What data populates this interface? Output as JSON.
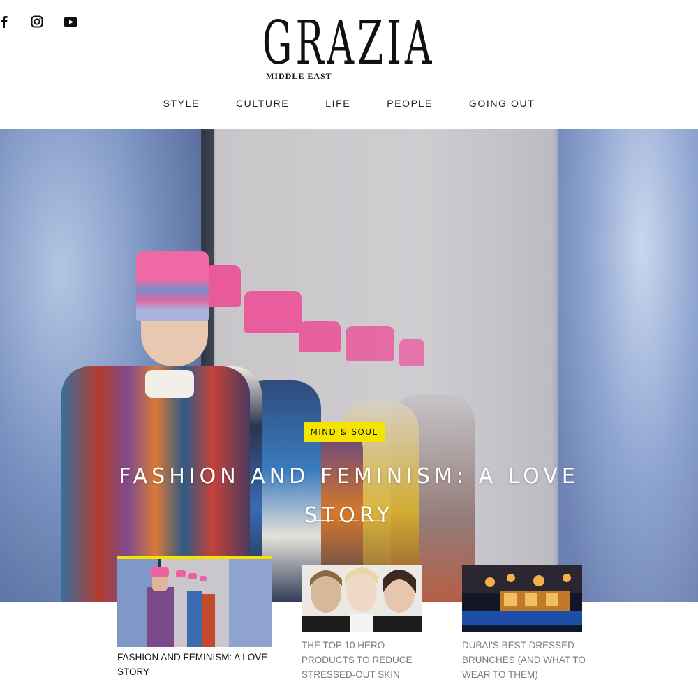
{
  "social": {
    "icons": [
      "facebook-icon",
      "instagram-icon",
      "youtube-icon"
    ]
  },
  "brand": {
    "name": "GRAZIA",
    "region": "MIDDLE EAST"
  },
  "nav": {
    "items": [
      "STYLE",
      "CULTURE",
      "LIFE",
      "PEOPLE",
      "GOING OUT"
    ]
  },
  "hero": {
    "title_line1": "FASHION AND FEMINISM: A LOVE",
    "title_line2": "STORY",
    "category": "MIND & SOUL",
    "slides_total": 3,
    "active_slide": 1
  },
  "cards": [
    {
      "title": "FASHION AND FEMINISM: A LOVE STORY",
      "active": true
    },
    {
      "title": "THE TOP 10 HERO PRODUCTS TO REDUCE STRESSED-OUT SKIN",
      "active": false
    },
    {
      "title": "DUBAI'S BEST-DRESSED BRUNCHES (AND WHAT TO WEAR TO THEM)",
      "active": false
    }
  ],
  "colors": {
    "accent": "#f5e400",
    "text": "#111111",
    "muted": "#7a7a7a"
  }
}
